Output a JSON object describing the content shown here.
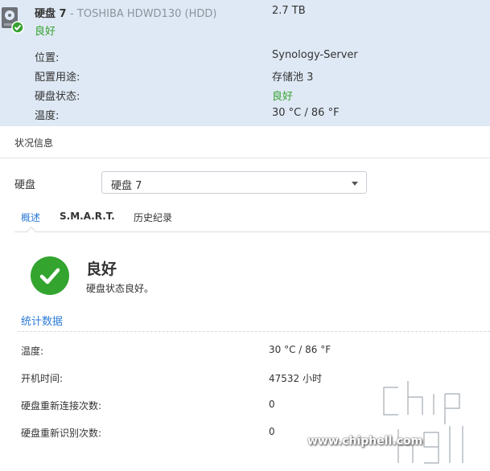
{
  "disk_card": {
    "name": "硬盘 7",
    "model": "- TOSHIBA HDWD130 (HDD)",
    "size": "2.7 TB",
    "health": "良好",
    "rows": [
      {
        "label": "位置:",
        "value": "Synology-Server",
        "status": "normal"
      },
      {
        "label": "配置用途:",
        "value": "存储池 3",
        "status": "normal"
      },
      {
        "label": "硬盘状态:",
        "value": "良好",
        "status": "good"
      },
      {
        "label": "温度:",
        "value": "30 °C / 86 °F",
        "status": "normal"
      }
    ]
  },
  "panel": {
    "title": "状况信息",
    "disk_field_label": "硬盘",
    "disk_select_value": "硬盘 7",
    "tabs": [
      {
        "label": "概述",
        "active": true
      },
      {
        "label": "S.M.A.R.T.",
        "active": false
      },
      {
        "label": "历史纪录",
        "active": false
      }
    ],
    "status_title": "良好",
    "status_desc": "硬盘状态良好。",
    "stats_title": "统计数据",
    "stats": [
      {
        "label": "温度:",
        "value": "30 °C / 86 °F"
      },
      {
        "label": "开机时间:",
        "value": "47532 小时"
      },
      {
        "label": "硬盘重新连接次数:",
        "value": "0"
      },
      {
        "label": "硬盘重新识别次数:",
        "value": "0"
      }
    ]
  },
  "watermark": {
    "url": "www.chiphell.com",
    "logo_text": "chiphell"
  },
  "colors": {
    "accent": "#2c7ad6",
    "good": "#36a12f",
    "card_bg": "#dfe9f5"
  },
  "icons": {
    "disk": "hdd-icon",
    "health_badge": "check-badge-icon",
    "status": "check-circle-icon",
    "dropdown": "caret-down-icon"
  }
}
